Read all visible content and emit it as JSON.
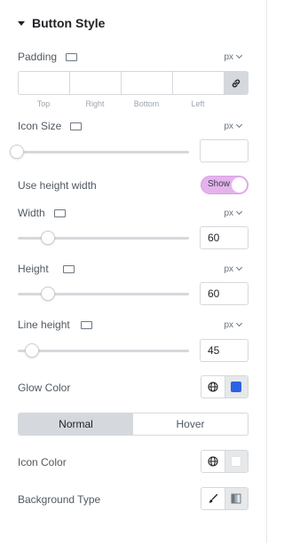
{
  "section": {
    "title": "Button Style"
  },
  "padding": {
    "label": "Padding",
    "unit": "px",
    "fields": [
      {
        "label": "Top",
        "value": ""
      },
      {
        "label": "Right",
        "value": ""
      },
      {
        "label": "Bottom",
        "value": ""
      },
      {
        "label": "Left",
        "value": ""
      }
    ],
    "link_icon": "link-icon"
  },
  "icon_size": {
    "label": "Icon Size",
    "unit": "px",
    "value": "",
    "slider_level": 0
  },
  "use_height_width": {
    "label": "Use height width",
    "toggle_text": "Show",
    "enabled": true
  },
  "width": {
    "label": "Width",
    "unit": "px",
    "value": "60",
    "slider_level": 0.18
  },
  "height": {
    "label": "Height",
    "unit": "px",
    "value": "60",
    "slider_level": 0.18
  },
  "line_height": {
    "label": "Line height",
    "unit": "px",
    "value": "45",
    "slider_level": 0.09
  },
  "glow_color": {
    "label": "Glow Color",
    "color": "#2d62e6",
    "globe_icon": "globe-icon"
  },
  "state_tabs": {
    "tabs": [
      "Normal",
      "Hover"
    ],
    "active": "Normal"
  },
  "icon_color": {
    "label": "Icon Color",
    "color": "#ffffff",
    "globe_icon": "globe-icon"
  },
  "background_type": {
    "label": "Background Type",
    "options": [
      "brush-icon",
      "gradient-icon"
    ]
  },
  "colors": {
    "accent_toggle": "#e5b3ec",
    "border": "#d5d8dc"
  }
}
